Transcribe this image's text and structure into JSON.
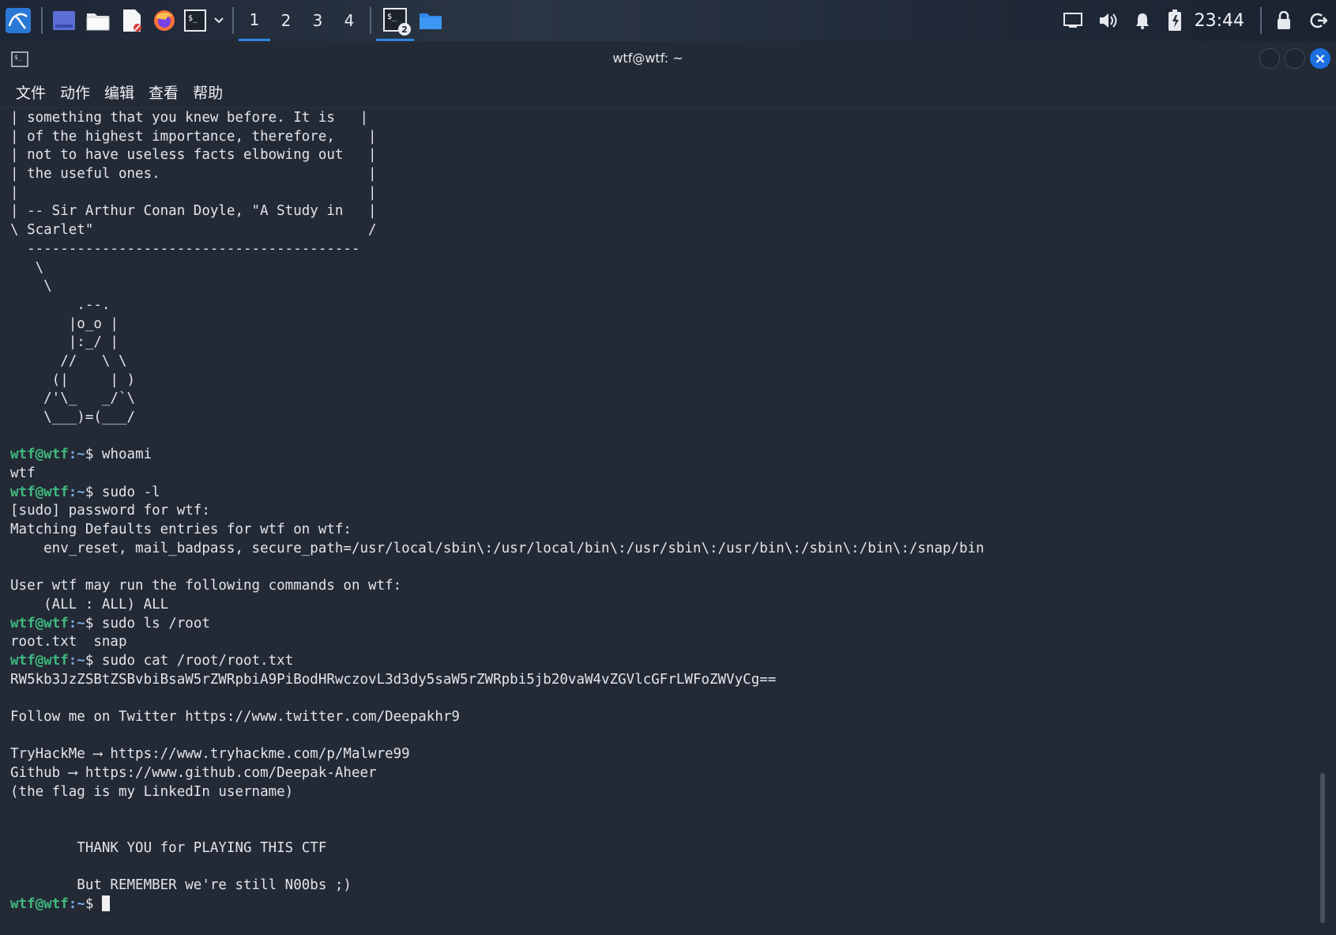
{
  "taskbar": {
    "workspaces": [
      "1",
      "2",
      "3",
      "4"
    ],
    "active_workspace": 0,
    "terminal_badge": "2",
    "clock": "23:44",
    "colors": {
      "accent": "#2f87e8",
      "panel": "#222b38"
    }
  },
  "window": {
    "title": "wtf@wtf: ~",
    "menus": [
      "文件",
      "动作",
      "编辑",
      "查看",
      "帮助"
    ],
    "close_glyph": "×"
  },
  "terminal": {
    "prompt_user": "wtf@wtf",
    "prompt_dir": ":~",
    "prompt_sign": "$",
    "lines": [
      {
        "t": "text",
        "v": "| something that you knew before. It is   |"
      },
      {
        "t": "text",
        "v": "| of the highest importance, therefore,    |"
      },
      {
        "t": "text",
        "v": "| not to have useless facts elbowing out   |"
      },
      {
        "t": "text",
        "v": "| the useful ones.                         |"
      },
      {
        "t": "text",
        "v": "|                                          |"
      },
      {
        "t": "text",
        "v": "| -- Sir Arthur Conan Doyle, \"A Study in   |"
      },
      {
        "t": "text",
        "v": "\\ Scarlet\"                                 /"
      },
      {
        "t": "text",
        "v": "  ----------------------------------------"
      },
      {
        "t": "text",
        "v": "   \\"
      },
      {
        "t": "text",
        "v": "    \\"
      },
      {
        "t": "text",
        "v": "        .--."
      },
      {
        "t": "text",
        "v": "       |o_o |"
      },
      {
        "t": "text",
        "v": "       |:_/ |"
      },
      {
        "t": "text",
        "v": "      //   \\ \\"
      },
      {
        "t": "text",
        "v": "     (|     | )"
      },
      {
        "t": "text",
        "v": "    /'\\_   _/`\\"
      },
      {
        "t": "text",
        "v": "    \\___)=(___/"
      },
      {
        "t": "text",
        "v": ""
      },
      {
        "t": "cmd",
        "v": "whoami"
      },
      {
        "t": "text",
        "v": "wtf"
      },
      {
        "t": "cmd",
        "v": "sudo -l"
      },
      {
        "t": "text",
        "v": "[sudo] password for wtf:"
      },
      {
        "t": "text",
        "v": "Matching Defaults entries for wtf on wtf:"
      },
      {
        "t": "text",
        "v": "    env_reset, mail_badpass, secure_path=/usr/local/sbin\\:/usr/local/bin\\:/usr/sbin\\:/usr/bin\\:/sbin\\:/bin\\:/snap/bin"
      },
      {
        "t": "text",
        "v": ""
      },
      {
        "t": "text",
        "v": "User wtf may run the following commands on wtf:"
      },
      {
        "t": "text",
        "v": "    (ALL : ALL) ALL"
      },
      {
        "t": "cmd",
        "v": "sudo ls /root"
      },
      {
        "t": "text",
        "v": "root.txt  snap"
      },
      {
        "t": "cmd",
        "v": "sudo cat /root/root.txt"
      },
      {
        "t": "text",
        "v": "RW5kb3JzZSBtZSBvbiBsaW5rZWRpbiA9PiBodHRwczovL3d3dy5saW5rZWRpbi5jb20vaW4vZGVlcGFrLWFoZWVyCg=="
      },
      {
        "t": "text",
        "v": ""
      },
      {
        "t": "text",
        "v": "Follow me on Twitter https://www.twitter.com/Deepakhr9"
      },
      {
        "t": "text",
        "v": ""
      },
      {
        "t": "text",
        "v": "TryHackMe ⟶ https://www.tryhackme.com/p/Malwre99"
      },
      {
        "t": "text",
        "v": "Github ⟶ https://www.github.com/Deepak-Aheer"
      },
      {
        "t": "text",
        "v": "(the flag is my LinkedIn username)"
      },
      {
        "t": "text",
        "v": ""
      },
      {
        "t": "text",
        "v": ""
      },
      {
        "t": "text",
        "v": "        THANK YOU for PLAYING THIS CTF"
      },
      {
        "t": "text",
        "v": ""
      },
      {
        "t": "text",
        "v": "        But REMEMBER we're still N00bs ;)"
      },
      {
        "t": "prompt",
        "v": ""
      }
    ]
  }
}
